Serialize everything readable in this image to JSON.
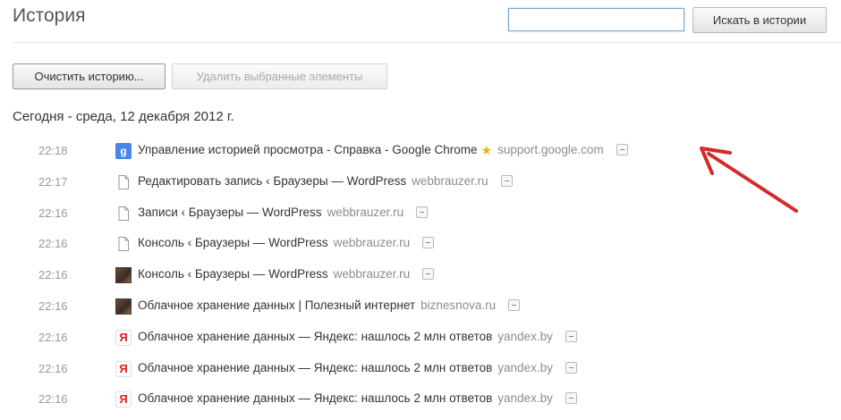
{
  "header": {
    "title": "История",
    "search_value": "",
    "search_button": "Искать в истории"
  },
  "toolbar": {
    "clear_label": "Очистить историю...",
    "delete_label": "Удалить выбранные элементы"
  },
  "day_heading": "Сегодня - среда, 12 декабря 2012 г.",
  "entries": [
    {
      "time": "22:18",
      "title": "Управление историей просмотра - Справка - Google Chrome",
      "domain": "support.google.com",
      "icon": "google-icon",
      "starred": true
    },
    {
      "time": "22:17",
      "title": "Редактировать запись ‹ Браузеры — WordPress",
      "domain": "webbrauzer.ru",
      "icon": "page-icon",
      "starred": false
    },
    {
      "time": "22:16",
      "title": "Записи ‹ Браузеры — WordPress",
      "domain": "webbrauzer.ru",
      "icon": "page-icon",
      "starred": false
    },
    {
      "time": "22:16",
      "title": "Консоль ‹ Браузеры — WordPress",
      "domain": "webbrauzer.ru",
      "icon": "page-icon",
      "starred": false
    },
    {
      "time": "22:16",
      "title": "Консоль ‹ Браузеры — WordPress",
      "domain": "webbrauzer.ru",
      "icon": "avatar-photo-icon",
      "starred": false
    },
    {
      "time": "22:16",
      "title": "Облачное хранение данных | Полезный интернет",
      "domain": "biznesnova.ru",
      "icon": "avatar-photo-icon",
      "starred": false
    },
    {
      "time": "22:16",
      "title": "Облачное хранение данных — Яндекс: нашлось 2 млн ответов",
      "domain": "yandex.by",
      "icon": "yandex-icon",
      "starred": false
    },
    {
      "time": "22:16",
      "title": "Облачное хранение данных — Яндекс: нашлось 2 млн ответов",
      "domain": "yandex.by",
      "icon": "yandex-icon",
      "starred": false
    },
    {
      "time": "22:16",
      "title": "Облачное хранение данных — Яндекс: нашлось 2 млн ответов",
      "domain": "yandex.by",
      "icon": "yandex-icon",
      "starred": false
    }
  ],
  "colors": {
    "annotation_arrow": "#d42a2a",
    "search_focus": "#7aa7d6"
  }
}
